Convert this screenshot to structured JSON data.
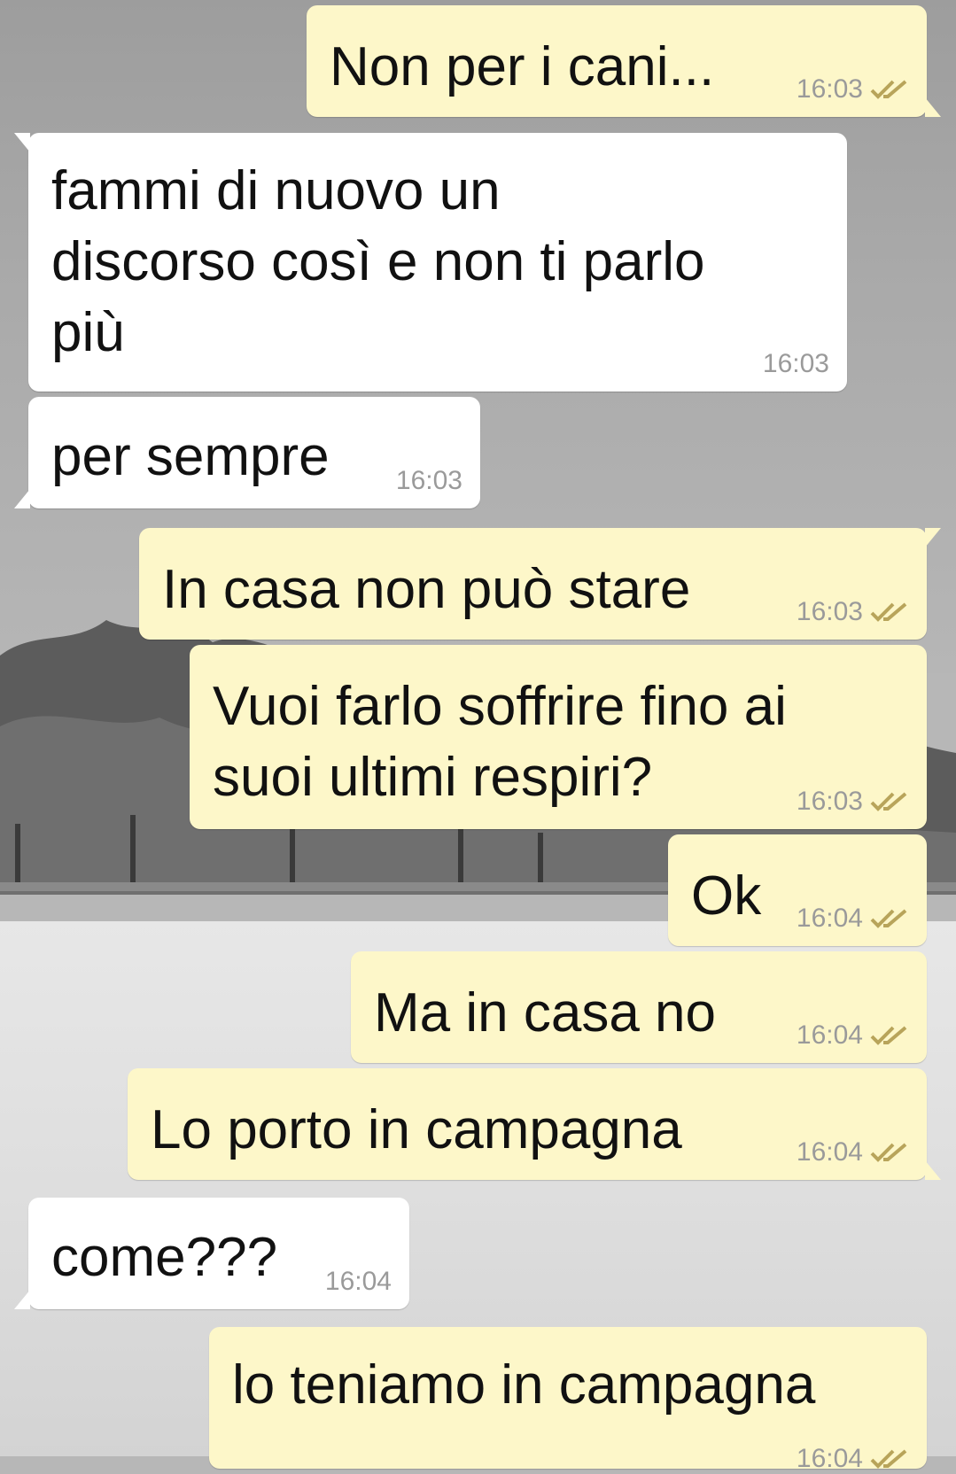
{
  "colors": {
    "incoming_bubble": "#ffffff",
    "outgoing_bubble": "#fdf7c9",
    "timestamp": "#9a9a9a",
    "read_ticks": "#b8a45a"
  },
  "messages": [
    {
      "direction": "out",
      "text": "Non per i cani...",
      "time": "16:03",
      "status_icon": "double-check-icon"
    },
    {
      "direction": "in",
      "lines": [
        "fammi di nuovo un",
        "discorso così e non ti parlo",
        "più"
      ],
      "time": "16:03"
    },
    {
      "direction": "in",
      "text": "per sempre",
      "time": "16:03"
    },
    {
      "direction": "out",
      "text": "In casa non può stare",
      "time": "16:03",
      "status_icon": "double-check-icon"
    },
    {
      "direction": "out",
      "lines": [
        "Vuoi farlo soffrire fino ai",
        "suoi ultimi respiri?"
      ],
      "time": "16:03",
      "status_icon": "double-check-icon"
    },
    {
      "direction": "out",
      "text": "Ok",
      "time": "16:04",
      "status_icon": "double-check-icon"
    },
    {
      "direction": "out",
      "text": "Ma in casa no",
      "time": "16:04",
      "status_icon": "double-check-icon"
    },
    {
      "direction": "out",
      "text": "Lo porto in campagna",
      "time": "16:04",
      "status_icon": "double-check-icon"
    },
    {
      "direction": "in",
      "text": "come???",
      "time": "16:04"
    },
    {
      "direction": "out",
      "text": "lo teniamo in campagna",
      "time": "16:04",
      "status_icon": "double-check-icon"
    }
  ]
}
